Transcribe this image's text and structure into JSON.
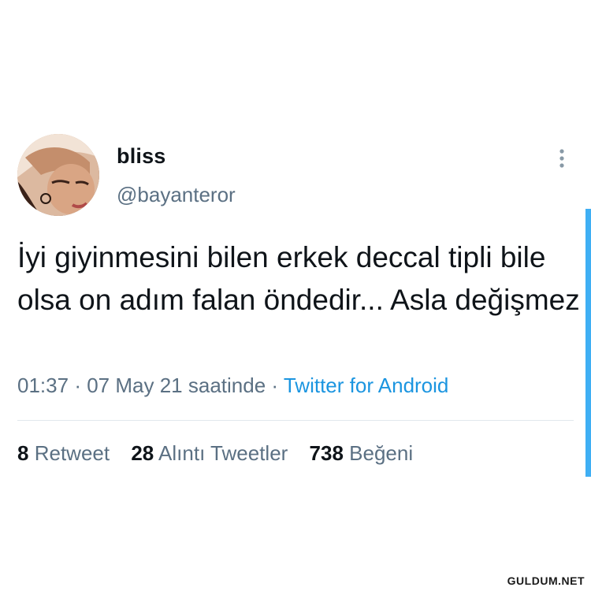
{
  "tweet": {
    "display_name": "bliss",
    "handle": "@bayanteror",
    "text": "İyi giyinmesini bilen erkek deccal tipli bile olsa on adım falan öndedir... Asla değişmez",
    "time": "01:37",
    "date": "07 May 21",
    "date_suffix": "saatinde",
    "separator": "·",
    "source": "Twitter for Android",
    "more_icon": "more-vertical-icon",
    "avatar_icon": "profile-photo"
  },
  "stats": {
    "retweets_count": "8",
    "retweets_label": "Retweet",
    "quotes_count": "28",
    "quotes_label": "Alıntı Tweetler",
    "likes_count": "738",
    "likes_label": "Beğeni"
  },
  "watermark": "GULDUM.NET",
  "colors": {
    "text_primary": "#0f1419",
    "text_secondary": "#5b7083",
    "link": "#1b95e0",
    "divider": "#e1e8ed"
  }
}
